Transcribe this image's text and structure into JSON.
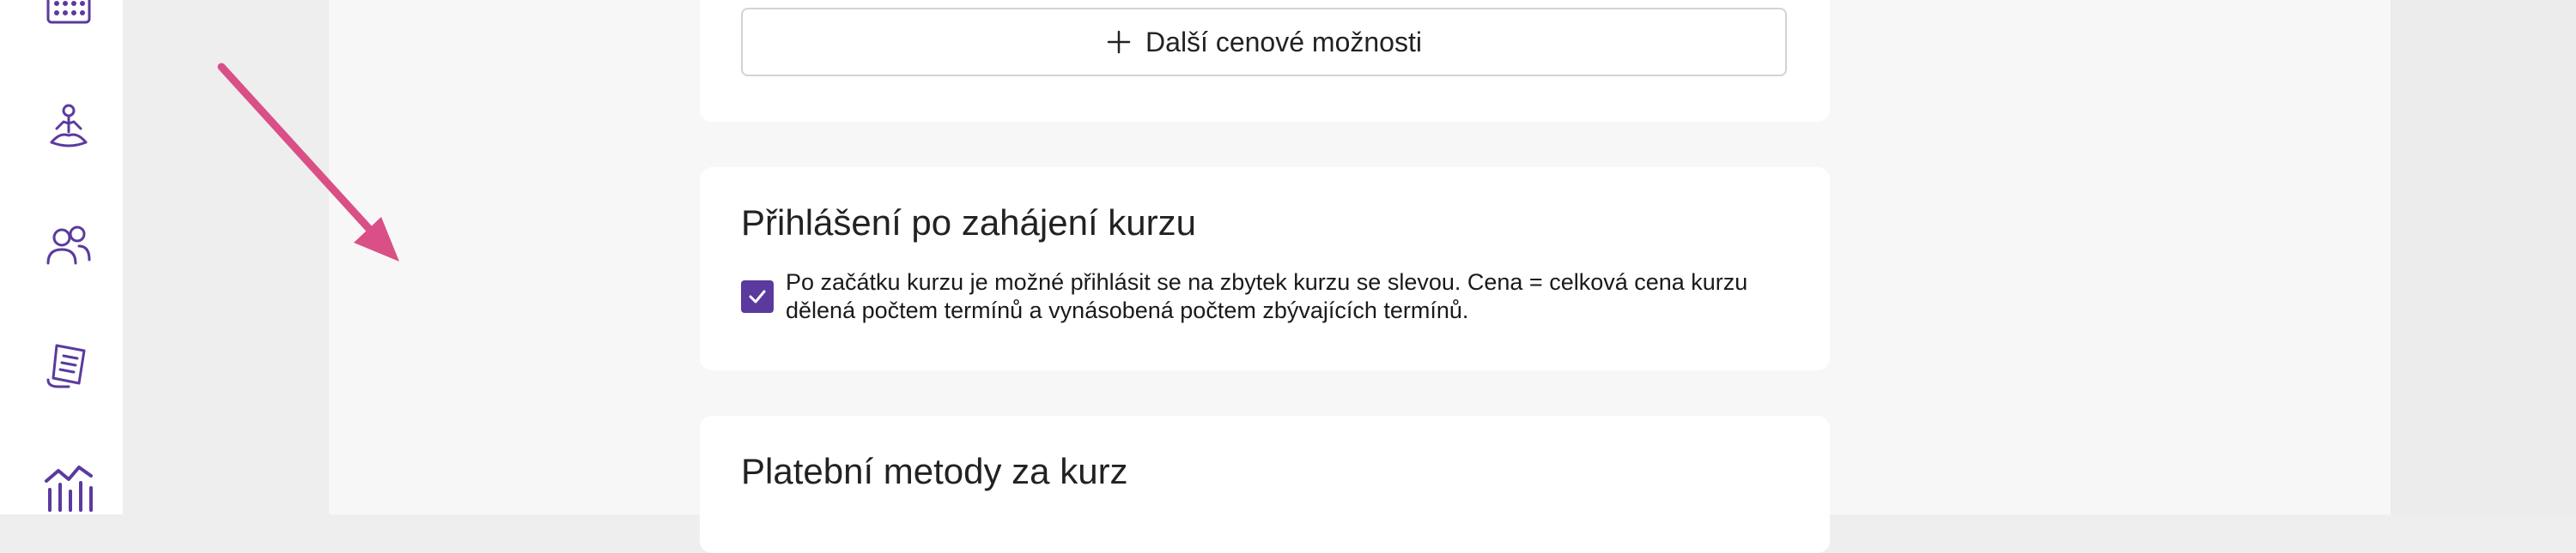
{
  "sidebar": {
    "items": [
      {
        "icon": "calendar-icon"
      },
      {
        "icon": "yoga-icon"
      },
      {
        "icon": "users-icon"
      },
      {
        "icon": "receipt-icon"
      },
      {
        "icon": "analytics-icon"
      }
    ]
  },
  "pricing": {
    "more_options_label": "Další cenové možnosti"
  },
  "registration": {
    "title": "Přihlášení po zahájení kurzu",
    "checkbox_checked": true,
    "checkbox_text": "Po začátku kurzu je možné přihlásit se na zbytek kurzu se slevou. Cena = celková cena kurzu dělená počtem termínů a vynásobená počtem zbývajících termínů."
  },
  "payment": {
    "title": "Platební metody za kurz"
  },
  "colors": {
    "accent": "#5b3a9e",
    "annotation_arrow": "#d94f86"
  }
}
